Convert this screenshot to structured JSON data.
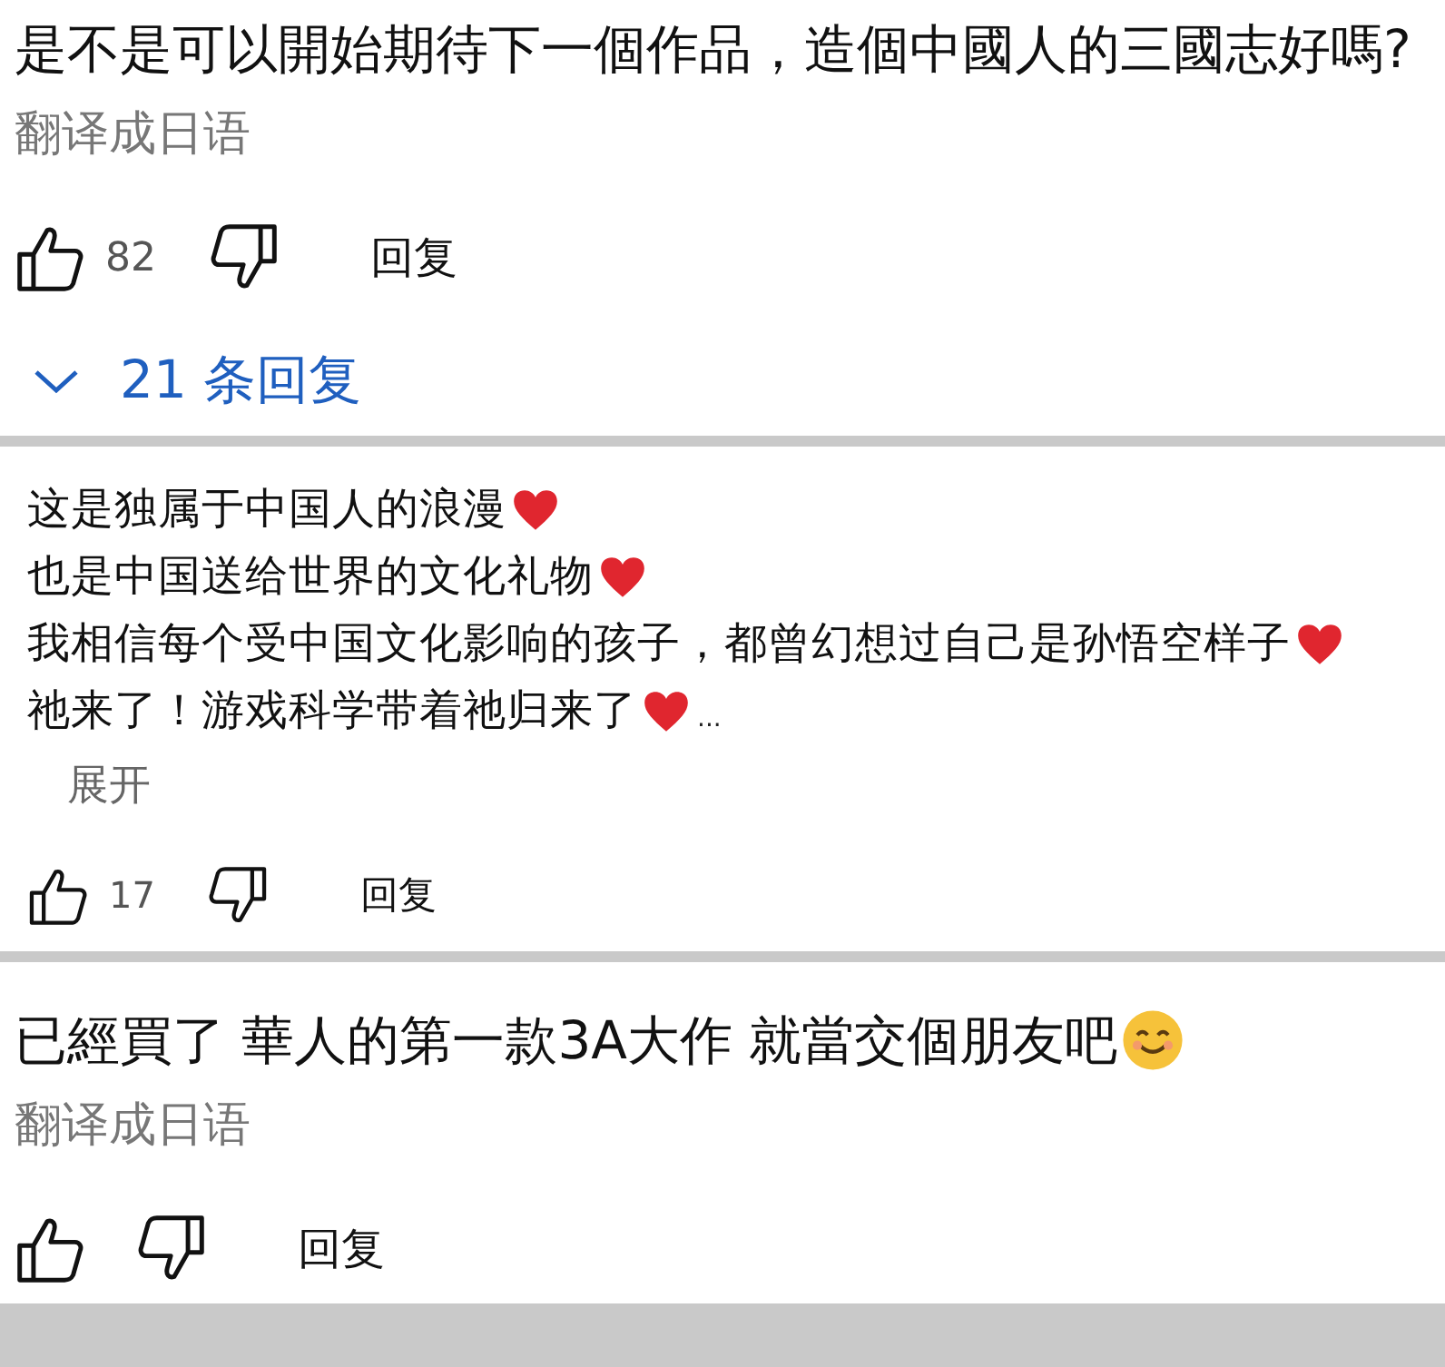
{
  "comments": [
    {
      "kind": "large",
      "lines": [
        {
          "text": "是不是可以開始期待下一個作品，造個中國人的三國志好嗎?"
        }
      ],
      "translate": "翻译成日语",
      "likes": "82",
      "reply": "回复",
      "replies": "21 条回复"
    },
    {
      "kind": "small",
      "lines": [
        {
          "text": "这是独属于中国人的浪漫",
          "kind": "heart"
        },
        {
          "text": "也是中国送给世界的文化礼物",
          "kind": "heart"
        },
        {
          "text": "我相信每个受中国文化影响的孩子，都曾幻想过自己是孙悟空样子",
          "kind": "heart"
        },
        {
          "text": "祂来了！游戏科学带着祂归来了",
          "kind": "heart",
          "ellipsis": "..."
        }
      ],
      "expand": "展开",
      "likes": "17",
      "reply": "回复"
    },
    {
      "kind": "large",
      "lines": [
        {
          "text": "已經買了 華人的第一款3A大作 就當交個朋友吧",
          "kind": "smile"
        }
      ],
      "translate": "翻译成日语",
      "reply": "回复"
    }
  ]
}
